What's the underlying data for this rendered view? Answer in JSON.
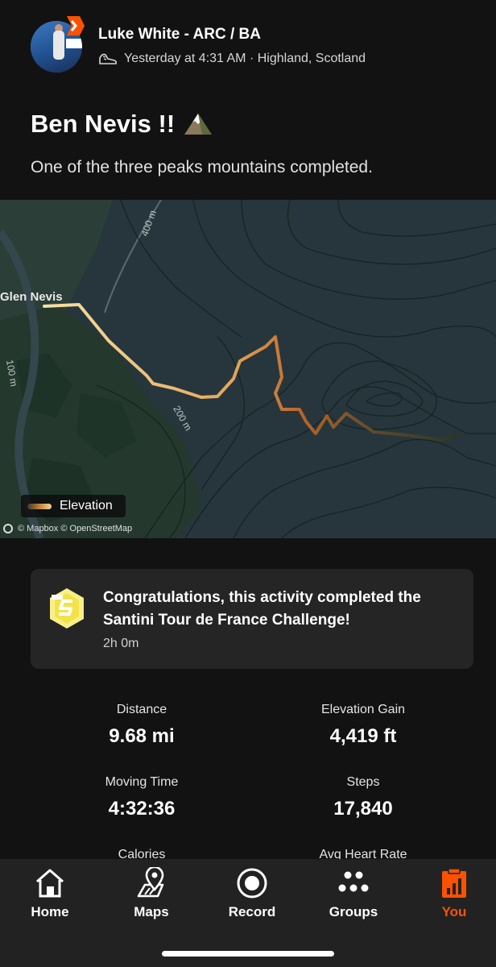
{
  "post": {
    "author": "Luke White - ARC / BA",
    "timestamp": "Yesterday at 4:31 AM · Highland, Scotland",
    "title": "Ben Nevis !!",
    "title_emoji": "mountain",
    "description": "One of the three peaks mountains completed."
  },
  "map": {
    "labels": {
      "place": "Glen Nevis",
      "contour_400": "400 m",
      "contour_100": "100 m",
      "contour_200": "200 m"
    },
    "legend_label": "Elevation",
    "attribution": "© Mapbox © OpenStreetMap"
  },
  "achievement": {
    "title": "Congratulations, this activity completed the Santini Tour de France Challenge!",
    "duration": "2h 0m"
  },
  "stats": [
    {
      "label": "Distance",
      "value": "9.68 mi"
    },
    {
      "label": "Elevation Gain",
      "value": "4,419 ft"
    },
    {
      "label": "Moving Time",
      "value": "4:32:36"
    },
    {
      "label": "Steps",
      "value": "17,840"
    },
    {
      "label": "Calories",
      "value": ""
    },
    {
      "label": "Avg Heart Rate",
      "value": ""
    }
  ],
  "tabs": [
    {
      "label": "Home",
      "icon": "home-icon"
    },
    {
      "label": "Maps",
      "icon": "map-icon"
    },
    {
      "label": "Record",
      "icon": "record-icon"
    },
    {
      "label": "Groups",
      "icon": "groups-icon"
    },
    {
      "label": "You",
      "icon": "you-icon",
      "active": true
    }
  ],
  "colors": {
    "accent": "#fc5200",
    "background": "#121212",
    "card": "#252525",
    "tabbar": "#222222"
  }
}
